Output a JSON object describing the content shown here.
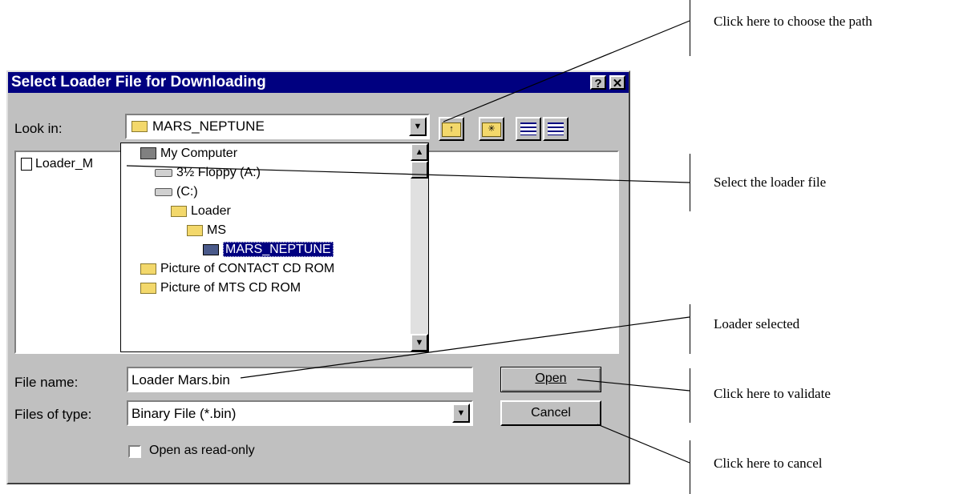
{
  "dialog": {
    "title": "Select Loader File for Downloading",
    "help_button": "?",
    "close_button": "✕",
    "look_in_label": "Look in:",
    "look_in_value": "MARS_NEPTUNE",
    "file_list": [
      "Loader_M"
    ],
    "tree": [
      {
        "label": "My Computer",
        "icon": "computer-icon"
      },
      {
        "label": "3½ Floppy (A:)",
        "icon": "floppy-drive-icon"
      },
      {
        "label": "(C:)",
        "icon": "hard-drive-icon"
      },
      {
        "label": "Loader",
        "icon": "folder-icon"
      },
      {
        "label": "MS",
        "icon": "folder-icon"
      },
      {
        "label": "MARS_NEPTUNE",
        "icon": "open-folder-icon",
        "selected": true
      },
      {
        "label": "Picture of CONTACT CD ROM",
        "icon": "folder-icon"
      },
      {
        "label": "Picture of MTS CD ROM",
        "icon": "folder-icon"
      }
    ],
    "file_name_label": "File name:",
    "file_name_value": "Loader Mars.bin",
    "files_of_type_label": "Files of type:",
    "files_of_type_value": "Binary File (*.bin)",
    "open_button": "Open",
    "cancel_button": "Cancel",
    "read_only_label": "Open as read-only",
    "read_only_checked": false
  },
  "annotations": {
    "choose_path": "Click here to choose the path",
    "select_loader": "Select the loader file",
    "loader_selected": "Loader selected",
    "validate": "Click here to validate",
    "cancel": "Click here to cancel"
  },
  "colors": {
    "title_bar": "#000080",
    "window_face": "#c0c0c0",
    "selection": "#000080"
  }
}
